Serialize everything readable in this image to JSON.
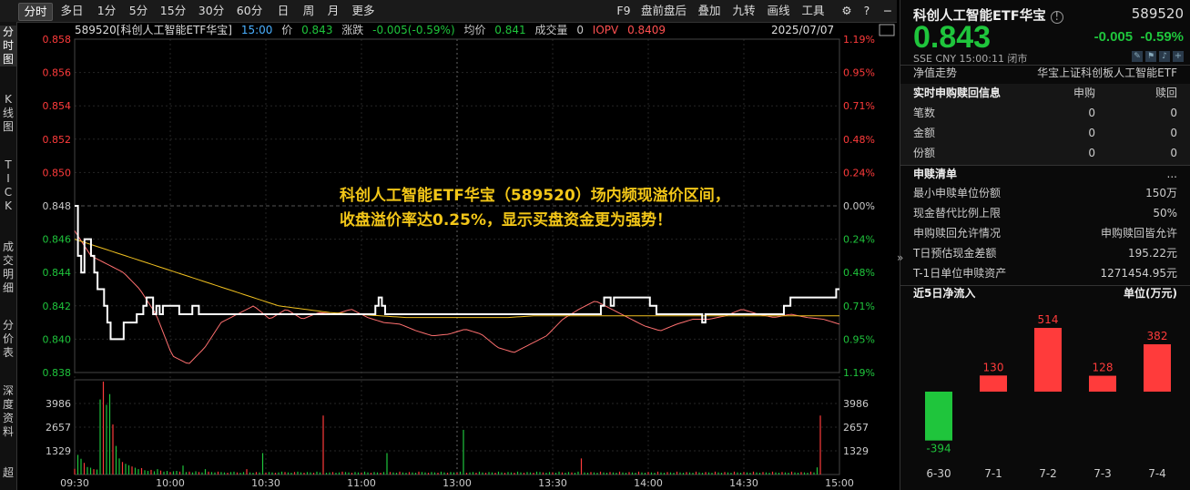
{
  "toolbar": {
    "periods": [
      "分时",
      "多日",
      "1分",
      "5分",
      "15分",
      "30分",
      "60分",
      "日",
      "周",
      "月",
      "更多"
    ],
    "active": "分时",
    "tools": [
      "F9",
      "盘前盘后",
      "叠加",
      "九转",
      "画线",
      "工具"
    ]
  },
  "sidebar": [
    "分\n时\n图",
    "K\n线\n图",
    "T\nI\nC\nK",
    "成\n交\n明\n细",
    "分\n价\n表",
    "深\n度\n资\n料",
    "超"
  ],
  "infobar": {
    "name": "589520[科创人工智能ETF华宝]",
    "time": "15:00",
    "price_label": "价",
    "price": "0.843",
    "chg_label": "涨跌",
    "chg": "-0.005(-0.59%)",
    "avg_label": "均价",
    "avg": "0.841",
    "vol_label": "成交量",
    "vol": "0",
    "iopv_label": "IOPV",
    "iopv": "0.8409",
    "date": "2025/07/07"
  },
  "annotation": {
    "line1": "科创人工智能ETF华宝（589520）场内频现溢价区间，",
    "line2": "收盘溢价率达0.25%，显示买盘资金更为强势！"
  },
  "colors": {
    "up": "#ff3b3b",
    "down": "#1fc53c",
    "price_line": "#ffffff",
    "avg_line": "#f0c020",
    "iopv_line": "#ff7070",
    "accent": "#f2c618"
  },
  "chart_data": {
    "type": "line",
    "y_ticks_left": [
      "0.858",
      "0.856",
      "0.854",
      "0.852",
      "0.850",
      "0.848",
      "0.846",
      "0.844",
      "0.842",
      "0.840",
      "0.838"
    ],
    "y_ticks_right": [
      "1.19%",
      "0.95%",
      "0.71%",
      "0.48%",
      "0.24%",
      "0.00%",
      "0.24%",
      "0.48%",
      "0.71%",
      "0.95%",
      "1.19%"
    ],
    "ylim": [
      0.838,
      0.858
    ],
    "prev_close": 0.848,
    "vol_ticks": [
      "3986",
      "2657",
      "1329"
    ],
    "vol_ticks_right": [
      "3986",
      "2657",
      "1329"
    ],
    "vol_max": 5300,
    "x_ticks": [
      "09:30",
      "10:00",
      "10:30",
      "11:00",
      "13:00",
      "13:30",
      "14:00",
      "14:30",
      "15:00"
    ],
    "price_segments": [
      [
        0,
        0.848
      ],
      [
        1,
        0.844
      ],
      [
        3,
        0.846
      ],
      [
        5,
        0.846
      ],
      [
        8,
        0.843
      ],
      [
        12,
        0.842
      ],
      [
        14,
        0.841
      ],
      [
        16,
        0.84
      ],
      [
        23,
        0.84
      ],
      [
        24,
        0.841
      ],
      [
        27,
        0.841
      ],
      [
        30,
        0.8415
      ],
      [
        33,
        0.8425
      ],
      [
        35,
        0.8425
      ],
      [
        38,
        0.8415
      ],
      [
        40,
        0.842
      ],
      [
        44,
        0.842
      ],
      [
        48,
        0.8415
      ],
      [
        52,
        0.8415
      ],
      [
        56,
        0.8415
      ],
      [
        60,
        0.8415
      ],
      [
        65,
        0.8415
      ],
      [
        72,
        0.8415
      ],
      [
        80,
        0.8415
      ],
      [
        88,
        0.8415
      ],
      [
        92,
        0.8415
      ],
      [
        94,
        0.842
      ],
      [
        96,
        0.8415
      ],
      [
        100,
        0.8415
      ],
      [
        104,
        0.8415
      ],
      [
        110,
        0.8415
      ],
      [
        112,
        0.841
      ],
      [
        116,
        0.8415
      ],
      [
        120,
        0.8415
      ],
      [
        125,
        0.8415
      ],
      [
        130,
        0.8415
      ],
      [
        135,
        0.8415
      ],
      [
        140,
        0.8415
      ],
      [
        145,
        0.8415
      ],
      [
        150,
        0.8415
      ],
      [
        155,
        0.8415
      ],
      [
        160,
        0.8415
      ],
      [
        165,
        0.8415
      ],
      [
        170,
        0.8415
      ],
      [
        175,
        0.8415
      ],
      [
        180,
        0.8415
      ],
      [
        185,
        0.841
      ],
      [
        190,
        0.8415
      ],
      [
        195,
        0.8415
      ],
      [
        200,
        0.8415
      ],
      [
        205,
        0.8415
      ],
      [
        210,
        0.8415
      ],
      [
        215,
        0.8415
      ],
      [
        220,
        0.8415
      ],
      [
        225,
        0.842
      ],
      [
        230,
        0.8425
      ],
      [
        235,
        0.8425
      ],
      [
        240,
        0.8415
      ],
      [
        236,
        0.8425
      ]
    ],
    "price": [
      0.848,
      0.845,
      0.844,
      0.846,
      0.846,
      0.845,
      0.844,
      0.843,
      0.843,
      0.842,
      0.841,
      0.84,
      0.84,
      0.84,
      0.84,
      0.841,
      0.841,
      0.841,
      0.841,
      0.8415,
      0.8415,
      0.842,
      0.8425,
      0.8425,
      0.8415,
      0.842,
      0.8415,
      0.842,
      0.842,
      0.842,
      0.842,
      0.842,
      0.8415,
      0.8415,
      0.8415,
      0.8415,
      0.842,
      0.842,
      0.8415,
      0.8415,
      0.8415,
      0.8415,
      0.8415,
      0.8415,
      0.8415,
      0.8415,
      0.8415,
      0.8415,
      0.8415,
      0.8415,
      0.8415,
      0.8415,
      0.8415,
      0.8415,
      0.8415,
      0.8415,
      0.8415,
      0.8415,
      0.8415,
      0.8415,
      0.8415,
      0.8415,
      0.8415,
      0.8415,
      0.8415,
      0.8415,
      0.8415,
      0.8415,
      0.8415,
      0.8415,
      0.8415,
      0.8415,
      0.8415,
      0.8415,
      0.8415,
      0.8415,
      0.8415,
      0.8415,
      0.8415,
      0.8415,
      0.8415,
      0.8415,
      0.8415,
      0.8415,
      0.8415,
      0.8415,
      0.8415,
      0.8415,
      0.8415,
      0.8415,
      0.8415,
      0.8415,
      0.842,
      0.8425,
      0.842,
      0.8415,
      0.8415,
      0.8415,
      0.8415,
      0.8415,
      0.8415,
      0.8415,
      0.8415,
      0.8415,
      0.8415,
      0.8415,
      0.8415,
      0.8415,
      0.8415,
      0.8415,
      0.8415,
      0.8415,
      0.8415,
      0.8415,
      0.8415,
      0.8415,
      0.8415,
      0.8415,
      0.8415,
      0.8415,
      0.8415,
      0.8415,
      0.8415,
      0.8415,
      0.8415,
      0.8415,
      0.8415,
      0.8415,
      0.8415,
      0.8415,
      0.8415,
      0.8415,
      0.8415,
      0.8415,
      0.8415,
      0.8415,
      0.8415,
      0.8415,
      0.8415,
      0.8415,
      0.8415,
      0.8415,
      0.8415,
      0.8415,
      0.8415,
      0.8415,
      0.8415,
      0.8415,
      0.8415,
      0.8415,
      0.8415,
      0.8415,
      0.8415,
      0.8415,
      0.8415,
      0.8415,
      0.8415,
      0.8415,
      0.8415,
      0.8415,
      0.8415,
      0.842,
      0.8425,
      0.8425,
      0.842,
      0.8425,
      0.8425,
      0.8425,
      0.8425,
      0.8425,
      0.8425,
      0.8425,
      0.8425,
      0.8425,
      0.8425,
      0.8425,
      0.842,
      0.842,
      0.8415,
      0.8415,
      0.8415,
      0.8415,
      0.8415,
      0.8415,
      0.8415,
      0.8415,
      0.8415,
      0.8415,
      0.8415,
      0.8415,
      0.8415,
      0.8415,
      0.841,
      0.8415,
      0.8415,
      0.8415,
      0.8415,
      0.8415,
      0.8415,
      0.8415,
      0.8415,
      0.8415,
      0.8415,
      0.8415,
      0.8415,
      0.8415,
      0.8415,
      0.8415,
      0.8415,
      0.8415,
      0.8415,
      0.8415,
      0.8415,
      0.8415,
      0.8415,
      0.8415,
      0.8415,
      0.842,
      0.842,
      0.8425,
      0.8425,
      0.8425,
      0.8425,
      0.8425,
      0.8425,
      0.8425,
      0.8425,
      0.8425,
      0.8425,
      0.8425,
      0.8425,
      0.8425,
      0.8425,
      0.843,
      0.843
    ],
    "avg": [
      0.846,
      0.8455,
      0.845,
      0.8445,
      0.844,
      0.8435,
      0.843,
      0.8425,
      0.842,
      0.8418,
      0.8416,
      0.8415,
      0.8414,
      0.8413,
      0.8413,
      0.8413,
      0.8413,
      0.8413,
      0.8414,
      0.8414,
      0.8414,
      0.8414,
      0.8414,
      0.8414,
      0.8414,
      0.8414,
      0.8414,
      0.8414,
      0.8414,
      0.8414,
      0.8414
    ],
    "iopv": [
      0.8465,
      0.845,
      0.8445,
      0.844,
      0.843,
      0.8415,
      0.839,
      0.8385,
      0.8395,
      0.841,
      0.8415,
      0.842,
      0.8412,
      0.8418,
      0.8412,
      0.8416,
      0.8415,
      0.8418,
      0.8413,
      0.841,
      0.8409,
      0.8405,
      0.8402,
      0.8403,
      0.8406,
      0.8403,
      0.8395,
      0.8392,
      0.8397,
      0.8402,
      0.8412,
      0.8418,
      0.8423,
      0.8418,
      0.8413,
      0.8408,
      0.8405,
      0.8409,
      0.8412,
      0.8412,
      0.8414,
      0.8418,
      0.8415,
      0.8413,
      0.8415,
      0.8413,
      0.8412,
      0.8409
    ],
    "volumes": [
      320,
      1100,
      880,
      650,
      420,
      380,
      300,
      280,
      4200,
      5200,
      3900,
      4500,
      2800,
      1600,
      900,
      700,
      600,
      520,
      450,
      380,
      300,
      360,
      240,
      200,
      260,
      180,
      300,
      220,
      160,
      200,
      140,
      180,
      200,
      160,
      500,
      140,
      160,
      120,
      180,
      140,
      120,
      300,
      160,
      140,
      120,
      160,
      140,
      120,
      100,
      140,
      160,
      120,
      100,
      140,
      300,
      120,
      100,
      140,
      120,
      1200,
      100,
      140,
      120,
      100,
      120,
      160,
      140,
      120,
      100,
      140,
      160,
      120,
      100,
      140,
      120,
      100,
      160,
      120,
      3300,
      100,
      120,
      140,
      100,
      120,
      160,
      140,
      120,
      100,
      140,
      120,
      100,
      160,
      120,
      100,
      140,
      120,
      100,
      140,
      1200,
      140,
      120,
      100,
      160,
      120,
      100,
      140,
      120,
      100,
      160,
      140,
      120,
      100,
      140,
      120,
      100,
      160,
      120,
      100,
      140,
      120,
      100,
      160,
      2500,
      100,
      120,
      140,
      100,
      160,
      120,
      100,
      140,
      120,
      100,
      160,
      120,
      100,
      140,
      120,
      100,
      160,
      120,
      100,
      140,
      120,
      100,
      160,
      140,
      120,
      100,
      140,
      120,
      100,
      160,
      120,
      100,
      140,
      120,
      100,
      160,
      900,
      120,
      100,
      140,
      120,
      100,
      160,
      120,
      100,
      140,
      120,
      100,
      160,
      120,
      100,
      140,
      120,
      100,
      160,
      120,
      100,
      140,
      120,
      100,
      160,
      120,
      100,
      140,
      120,
      100,
      160,
      120,
      100,
      140,
      120,
      100,
      160,
      120,
      100,
      140,
      120,
      100,
      160,
      120,
      100,
      140,
      120,
      100,
      160,
      120,
      100,
      140,
      120,
      100,
      160,
      120,
      100,
      140,
      120,
      100,
      160,
      120,
      100,
      140,
      120,
      100,
      160,
      120,
      100,
      140,
      120,
      100,
      160,
      120,
      400,
      3300
    ],
    "vol_colors_up_index_mod": 3
  },
  "right": {
    "title": "科创人工智能ETF华宝",
    "code": "589520",
    "price": "0.843",
    "chg": "-0.005",
    "chg_pct": "-0.59%",
    "sub": "SSE  CNY  15:00:11  闭市",
    "nav_label": "净值走势",
    "nav_index": "华宝上证科创板人工智能ETF",
    "realtime": {
      "title": "实时申购赎回信息",
      "col1": "申购",
      "col2": "赎回",
      "rows": [
        {
          "k": "笔数",
          "a": "0",
          "b": "0"
        },
        {
          "k": "金额",
          "a": "0",
          "b": "0"
        },
        {
          "k": "份额",
          "a": "0",
          "b": "0"
        }
      ]
    },
    "list_title": "申赎清单",
    "list_more": "...",
    "list": [
      {
        "k": "最小申赎单位份额",
        "v": "150万"
      },
      {
        "k": "现金替代比例上限",
        "v": "50%"
      },
      {
        "k": "申购赎回允许情况",
        "v": "申购赎回皆允许"
      },
      {
        "k": "T日预估现金差额",
        "v": "195.22元"
      },
      {
        "k": "T-1日单位申赎资产",
        "v": "1271454.95元"
      }
    ],
    "flow_title": "近5日净流入",
    "flow_unit": "单位(万元)",
    "flow_chart": {
      "type": "bar",
      "categories": [
        "6-30",
        "7-1",
        "7-2",
        "7-3",
        "7-4"
      ],
      "values": [
        -394,
        130,
        514,
        128,
        382
      ]
    }
  }
}
